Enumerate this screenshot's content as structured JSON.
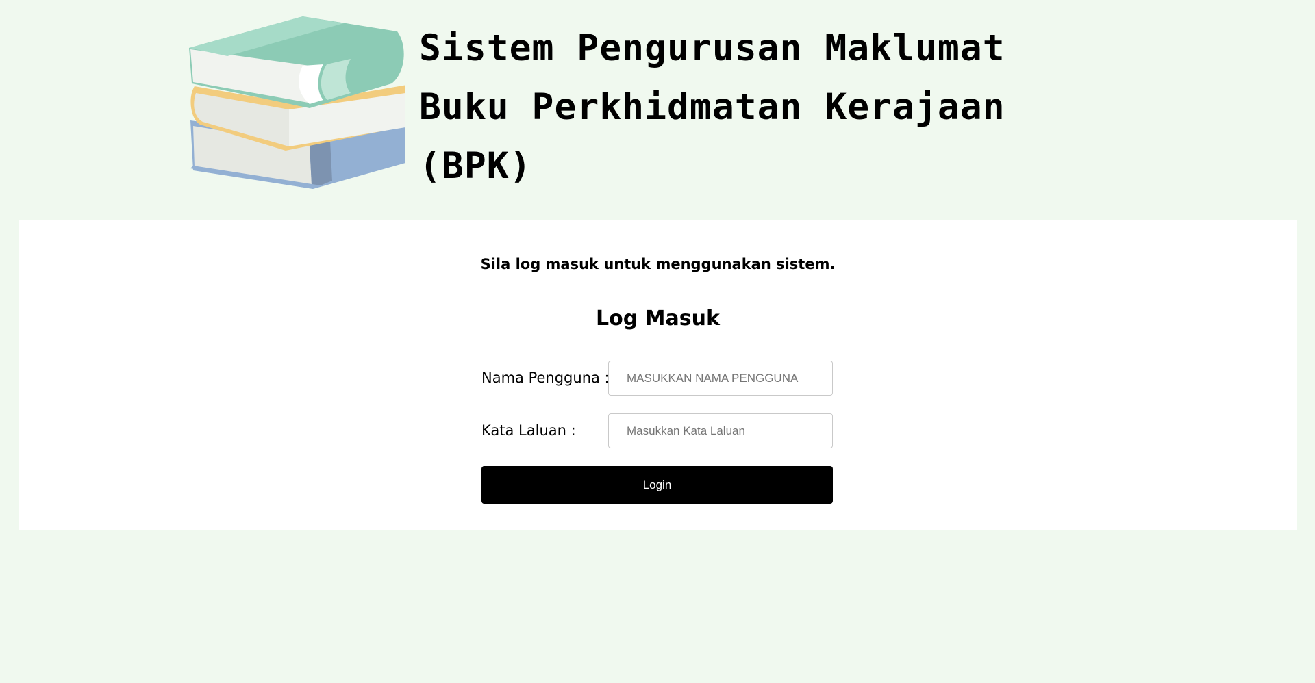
{
  "header": {
    "title_lines": [
      "Sistem Pengurusan Maklumat",
      "Buku Perkhidmatan Kerajaan",
      "(BPK)"
    ],
    "logo_icon": "stack-of-books-icon"
  },
  "main": {
    "notice": "Sila log masuk untuk menggunakan sistem.",
    "form_title": "Log Masuk",
    "username": {
      "label": "Nama Pengguna :",
      "placeholder": "MASUKKAN NAMA PENGGUNA",
      "value": ""
    },
    "password": {
      "label": "Kata Laluan :",
      "placeholder": "Masukkan Kata Laluan",
      "value": ""
    },
    "login_label": "Login"
  },
  "colors": {
    "page_background": "#f0f9ef",
    "panel_background": "#ffffff",
    "button_background": "#000000",
    "button_text": "#ffffff",
    "book_green": "#8ccbb5",
    "book_yellow": "#f2cc7e",
    "book_blue": "#93b0d3"
  }
}
